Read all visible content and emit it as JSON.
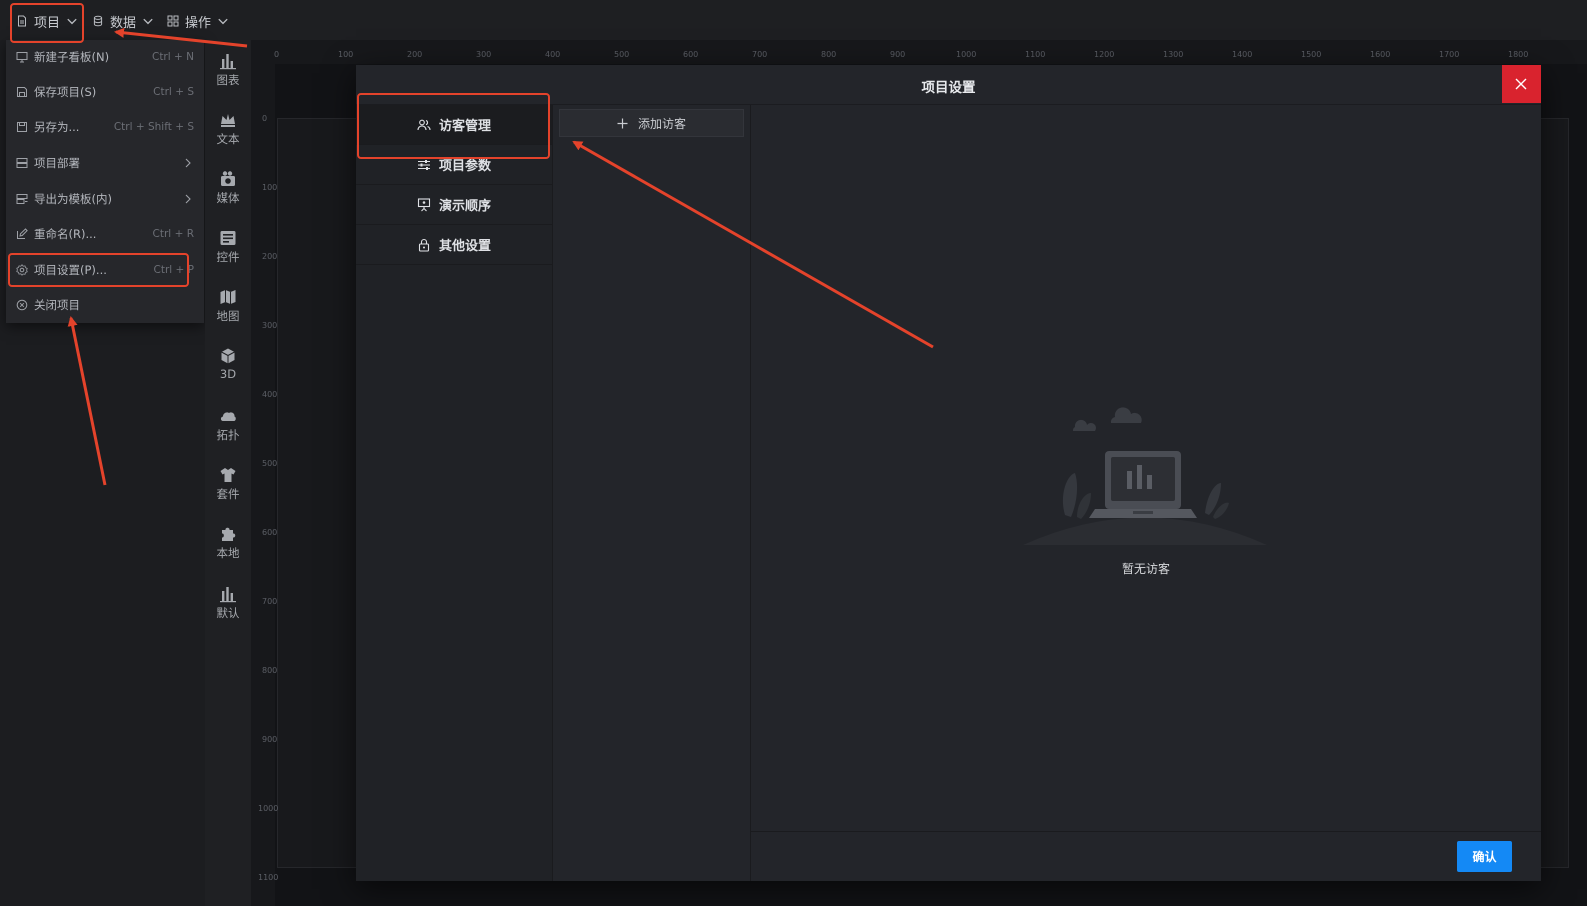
{
  "menubar": {
    "project": "项目",
    "data": "数据",
    "operate": "操作"
  },
  "dropdown": {
    "items": [
      {
        "label": "新建子看板(N)",
        "shortcut": "Ctrl + N",
        "icon": "board-icon"
      },
      {
        "label": "保存项目(S)",
        "shortcut": "Ctrl + S",
        "icon": "save-icon"
      },
      {
        "label": "另存为...",
        "shortcut": "Ctrl + Shift + S",
        "icon": "save-as-icon"
      },
      {
        "label": "项目部署",
        "shortcut": "",
        "icon": "deploy-icon"
      },
      {
        "label": "导出为模板(内)",
        "shortcut": "",
        "icon": "export-icon"
      },
      {
        "label": "重命名(R)...",
        "shortcut": "Ctrl + R",
        "icon": "rename-icon"
      },
      {
        "label": "项目设置(P)...",
        "shortcut": "Ctrl + P",
        "icon": "gear-icon"
      },
      {
        "label": "关闭项目",
        "shortcut": "",
        "icon": "close-circle-icon"
      }
    ]
  },
  "components": [
    "图表",
    "文本",
    "媒体",
    "控件",
    "地图",
    "3D",
    "拓扑",
    "套件",
    "本地",
    "默认"
  ],
  "ruler": {
    "h": [
      "0",
      "100",
      "200",
      "300",
      "400",
      "500",
      "600",
      "700",
      "800",
      "900",
      "1000",
      "1100",
      "1200",
      "1300",
      "1400",
      "1500",
      "1600",
      "1700",
      "1800"
    ],
    "v": [
      "0",
      "100",
      "200",
      "300",
      "400",
      "500",
      "600",
      "700",
      "800",
      "900",
      "1000",
      "1100"
    ]
  },
  "modal": {
    "title": "项目设置",
    "nav": [
      "访客管理",
      "项目参数",
      "演示顺序",
      "其他设置"
    ],
    "add_visitor": "添加访客",
    "empty": "暂无访客",
    "confirm": "确认"
  },
  "colors": {
    "accent": "#1489f5",
    "close": "#d9232e",
    "annotation": "#e4432b"
  }
}
